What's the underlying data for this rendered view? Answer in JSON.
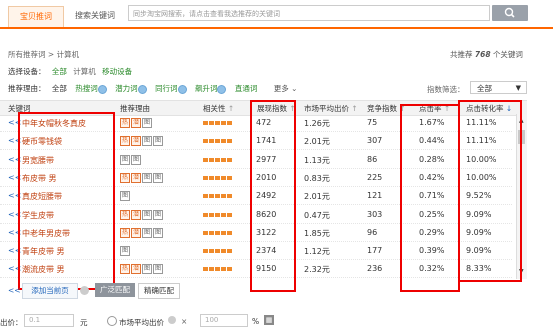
{
  "tabs": [
    {
      "label": "宝贝推词",
      "active": true
    },
    {
      "label": "搜索关键词",
      "active": false
    }
  ],
  "search": {
    "placeholder": "同步淘宝网搜索，请点击查看我选推荐的关键词"
  },
  "breadcrumb": {
    "all": "所有推荐词",
    "sep": ">",
    "category": "计算机"
  },
  "total": {
    "prefix": "共推荐",
    "count": "768",
    "suffix": "个关键词"
  },
  "device": {
    "label": "选择设备：",
    "options": [
      "全部",
      "计算机",
      "移动设备"
    ]
  },
  "reason_filter": {
    "label": "推荐理由：",
    "options": [
      "全部",
      "热搜词",
      "潜力词",
      "同行词",
      "飙升词",
      "直通词"
    ],
    "more": "更多"
  },
  "index_filter": {
    "label": "指数筛选：",
    "value": "全部"
  },
  "columns": {
    "keyword": "关键词",
    "reason": "推荐理由",
    "relevance": "相关性",
    "impressions": "展现指数",
    "avg_price": "市场平均出价",
    "competition": "竞争指数",
    "ctr": "点击率",
    "cvr": "点击转化率"
  },
  "rows": [
    {
      "keyword": "中年女帽秋冬真皮",
      "tags": [
        "热",
        "潜",
        "图"
      ],
      "impr": "472",
      "price": "1.26元",
      "comp": "75",
      "ctr": "1.67%",
      "cvr": "11.11%"
    },
    {
      "keyword": "硬币零钱袋",
      "tags": [
        "热",
        "潜",
        "图",
        "图"
      ],
      "impr": "1741",
      "price": "2.01元",
      "comp": "307",
      "ctr": "0.44%",
      "cvr": "11.11%"
    },
    {
      "keyword": "男宽腰带",
      "tags": [
        "图",
        "图"
      ],
      "impr": "2977",
      "price": "1.13元",
      "comp": "86",
      "ctr": "0.28%",
      "cvr": "10.00%"
    },
    {
      "keyword": "布皮带 男",
      "tags": [
        "热",
        "潜",
        "图",
        "图"
      ],
      "impr": "2010",
      "price": "0.83元",
      "comp": "225",
      "ctr": "0.42%",
      "cvr": "10.00%"
    },
    {
      "keyword": "真皮短腰带",
      "tags": [
        "图"
      ],
      "impr": "2492",
      "price": "2.01元",
      "comp": "121",
      "ctr": "0.71%",
      "cvr": "9.52%"
    },
    {
      "keyword": "学生皮带",
      "tags": [
        "热",
        "潜",
        "图",
        "图"
      ],
      "impr": "8620",
      "price": "0.47元",
      "comp": "303",
      "ctr": "0.25%",
      "cvr": "9.09%"
    },
    {
      "keyword": "中老年男皮带",
      "tags": [
        "热",
        "潜",
        "图",
        "图"
      ],
      "impr": "3122",
      "price": "1.85元",
      "comp": "96",
      "ctr": "0.29%",
      "cvr": "9.09%"
    },
    {
      "keyword": "青年皮带 男",
      "tags": [
        "图"
      ],
      "impr": "2374",
      "price": "1.12元",
      "comp": "177",
      "ctr": "0.39%",
      "cvr": "9.09%"
    },
    {
      "keyword": "潮流皮带 男",
      "tags": [
        "热",
        "潜",
        "图",
        "图"
      ],
      "impr": "9150",
      "price": "2.32元",
      "comp": "236",
      "ctr": "0.32%",
      "cvr": "8.33%"
    }
  ],
  "row_prefix": "<<",
  "footer": {
    "add_page": "添加当前页",
    "broad_match": "广泛匹配",
    "exact_match": "精确匹配"
  },
  "bid": {
    "label": "出价：",
    "value": "0.1",
    "unit": "元",
    "market_label": "市场平均出价",
    "percent_value": "100",
    "percent_unit": "%"
  }
}
